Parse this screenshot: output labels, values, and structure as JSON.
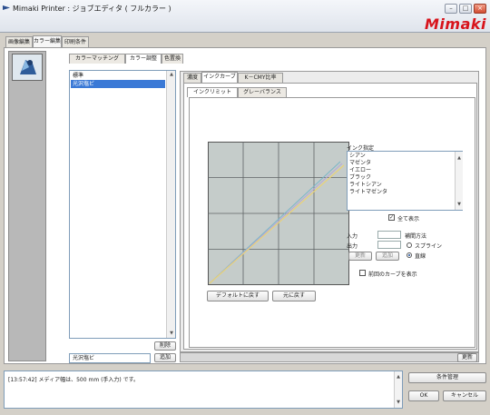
{
  "window": {
    "title": "Mimaki Printer : ジョブエディタ ( フルカラー )",
    "logo": "Mimaki",
    "controls": [
      "minimize-icon",
      "maximize-icon",
      "close-icon"
    ]
  },
  "top_tabs": [
    "画像編集",
    "カラー編集",
    "印刷条件"
  ],
  "sub_tabs": [
    "カラーマッチング",
    "カラー調整",
    "色置換"
  ],
  "profile_list": {
    "items": [
      "標準",
      "光沢塩ビ"
    ],
    "selected_index": 1
  },
  "left_buttons": {
    "delete": "削除",
    "add": "追加",
    "name_value": "光沢塩ビ"
  },
  "right_tabs": [
    "濃度",
    "インクカーブ",
    "K－CMY比率"
  ],
  "inner_tabs": [
    "インクリミット",
    "グレーバランス"
  ],
  "ink": {
    "label": "インク指定",
    "items": [
      "シアン",
      "マゼンタ",
      "イエロー",
      "ブラック",
      "ライトシアン",
      "ライトマゼンタ"
    ],
    "show_all_label": "全て表示",
    "show_all_checked": true
  },
  "io": {
    "input_label": "入力",
    "output_label": "出力",
    "update_button": "更新",
    "add_button": "追加"
  },
  "interpolation": {
    "label": "補間方法",
    "options": [
      "スプライン",
      "直線"
    ],
    "selected": "直線"
  },
  "prev_curve_label": "前回のカーブを表示",
  "graph_buttons": {
    "default": "デフォルトに戻す",
    "revert": "元に戻す"
  },
  "bottom_update": "更新",
  "message": "[13:57:42] メディア幅は、500 mm (手入力) です。",
  "actions": {
    "condition": "条件管理",
    "ok": "OK",
    "cancel": "キャンセル"
  },
  "colors": {
    "logo": "#d8141c",
    "selection": "#3a79d6",
    "grid_bg": "#c5ccca",
    "curve_a": "#e8d278",
    "curve_b": "#b6a8d6",
    "curve_c": "#7ab6c8"
  }
}
